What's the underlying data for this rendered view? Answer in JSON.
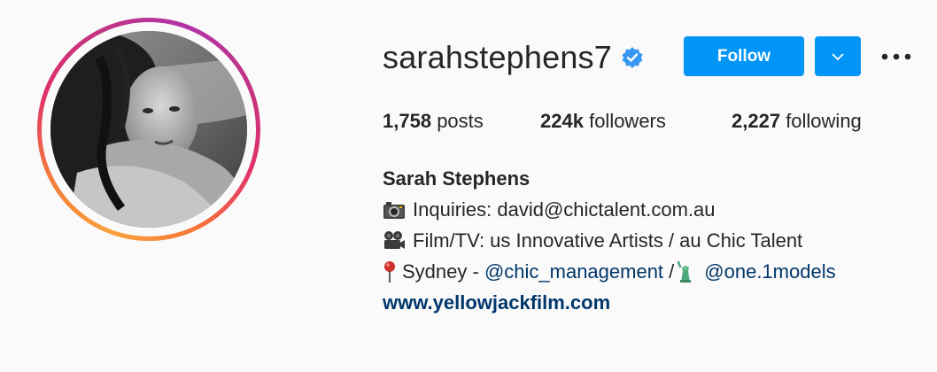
{
  "profile": {
    "username": "sarahstephens7",
    "verified": true,
    "follow_label": "Follow",
    "stats": {
      "posts_count": "1,758",
      "posts_label": "posts",
      "followers_count": "224k",
      "followers_label": "followers",
      "following_count": "2,227",
      "following_label": "following"
    },
    "full_name": "Sarah Stephens",
    "bio": {
      "line1_text": "Inquiries: david@chictalent.com.au",
      "line2_text": "Film/TV: us Innovative Artists / au Chic Talent",
      "line3_prefix": "Sydney - ",
      "line3_mention1": "@chic_management",
      "line3_sep": " /",
      "line3_mention2": "@one.1models",
      "website": "www.yellowjackfilm.com"
    }
  },
  "icons": {
    "verified": "verified-badge-icon",
    "dropdown": "chevron-down-icon",
    "more": "more-options-icon",
    "line1": "camera-emoji",
    "line2": "movie-camera-emoji",
    "line3a": "round-pushpin-emoji",
    "line3b": "statue-of-liberty-emoji"
  },
  "colors": {
    "primary_blue": "#0095f6",
    "link_blue": "#00376b",
    "text": "#262626",
    "background": "#fafafa"
  }
}
